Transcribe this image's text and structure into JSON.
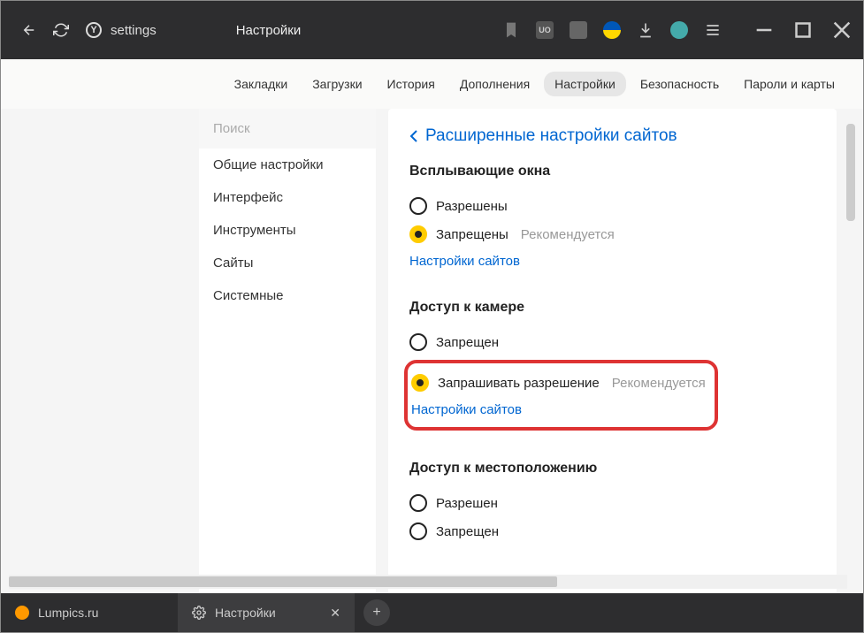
{
  "titlebar": {
    "url_text": "settings",
    "page_title": "Настройки"
  },
  "top_tabs": {
    "items": [
      "Закладки",
      "Загрузки",
      "История",
      "Дополнения",
      "Настройки",
      "Безопасность",
      "Пароли и карты"
    ],
    "active_index": 4
  },
  "sidebar": {
    "search_placeholder": "Поиск",
    "items": [
      "Общие настройки",
      "Интерфейс",
      "Инструменты",
      "Сайты",
      "Системные"
    ]
  },
  "main": {
    "header": "Расширенные настройки сайтов",
    "sections": [
      {
        "title": "Всплывающие окна",
        "options": [
          {
            "label": "Разрешены",
            "selected": false,
            "hint": ""
          },
          {
            "label": "Запрещены",
            "selected": true,
            "hint": "Рекомендуется"
          }
        ],
        "link": "Настройки сайтов"
      },
      {
        "title": "Доступ к камере",
        "options": [
          {
            "label": "Запрещен",
            "selected": false,
            "hint": ""
          },
          {
            "label": "Запрашивать разрешение",
            "selected": true,
            "hint": "Рекомендуется"
          }
        ],
        "link": "Настройки сайтов",
        "highlighted": true
      },
      {
        "title": "Доступ к местоположению",
        "options": [
          {
            "label": "Разрешен",
            "selected": false,
            "hint": ""
          },
          {
            "label": "Запрещен",
            "selected": false,
            "hint": ""
          }
        ]
      }
    ]
  },
  "bottom_tabs": {
    "items": [
      {
        "label": "Lumpics.ru",
        "icon": "lumpics"
      },
      {
        "label": "Настройки",
        "icon": "gear",
        "active": true,
        "closeable": true
      }
    ]
  }
}
